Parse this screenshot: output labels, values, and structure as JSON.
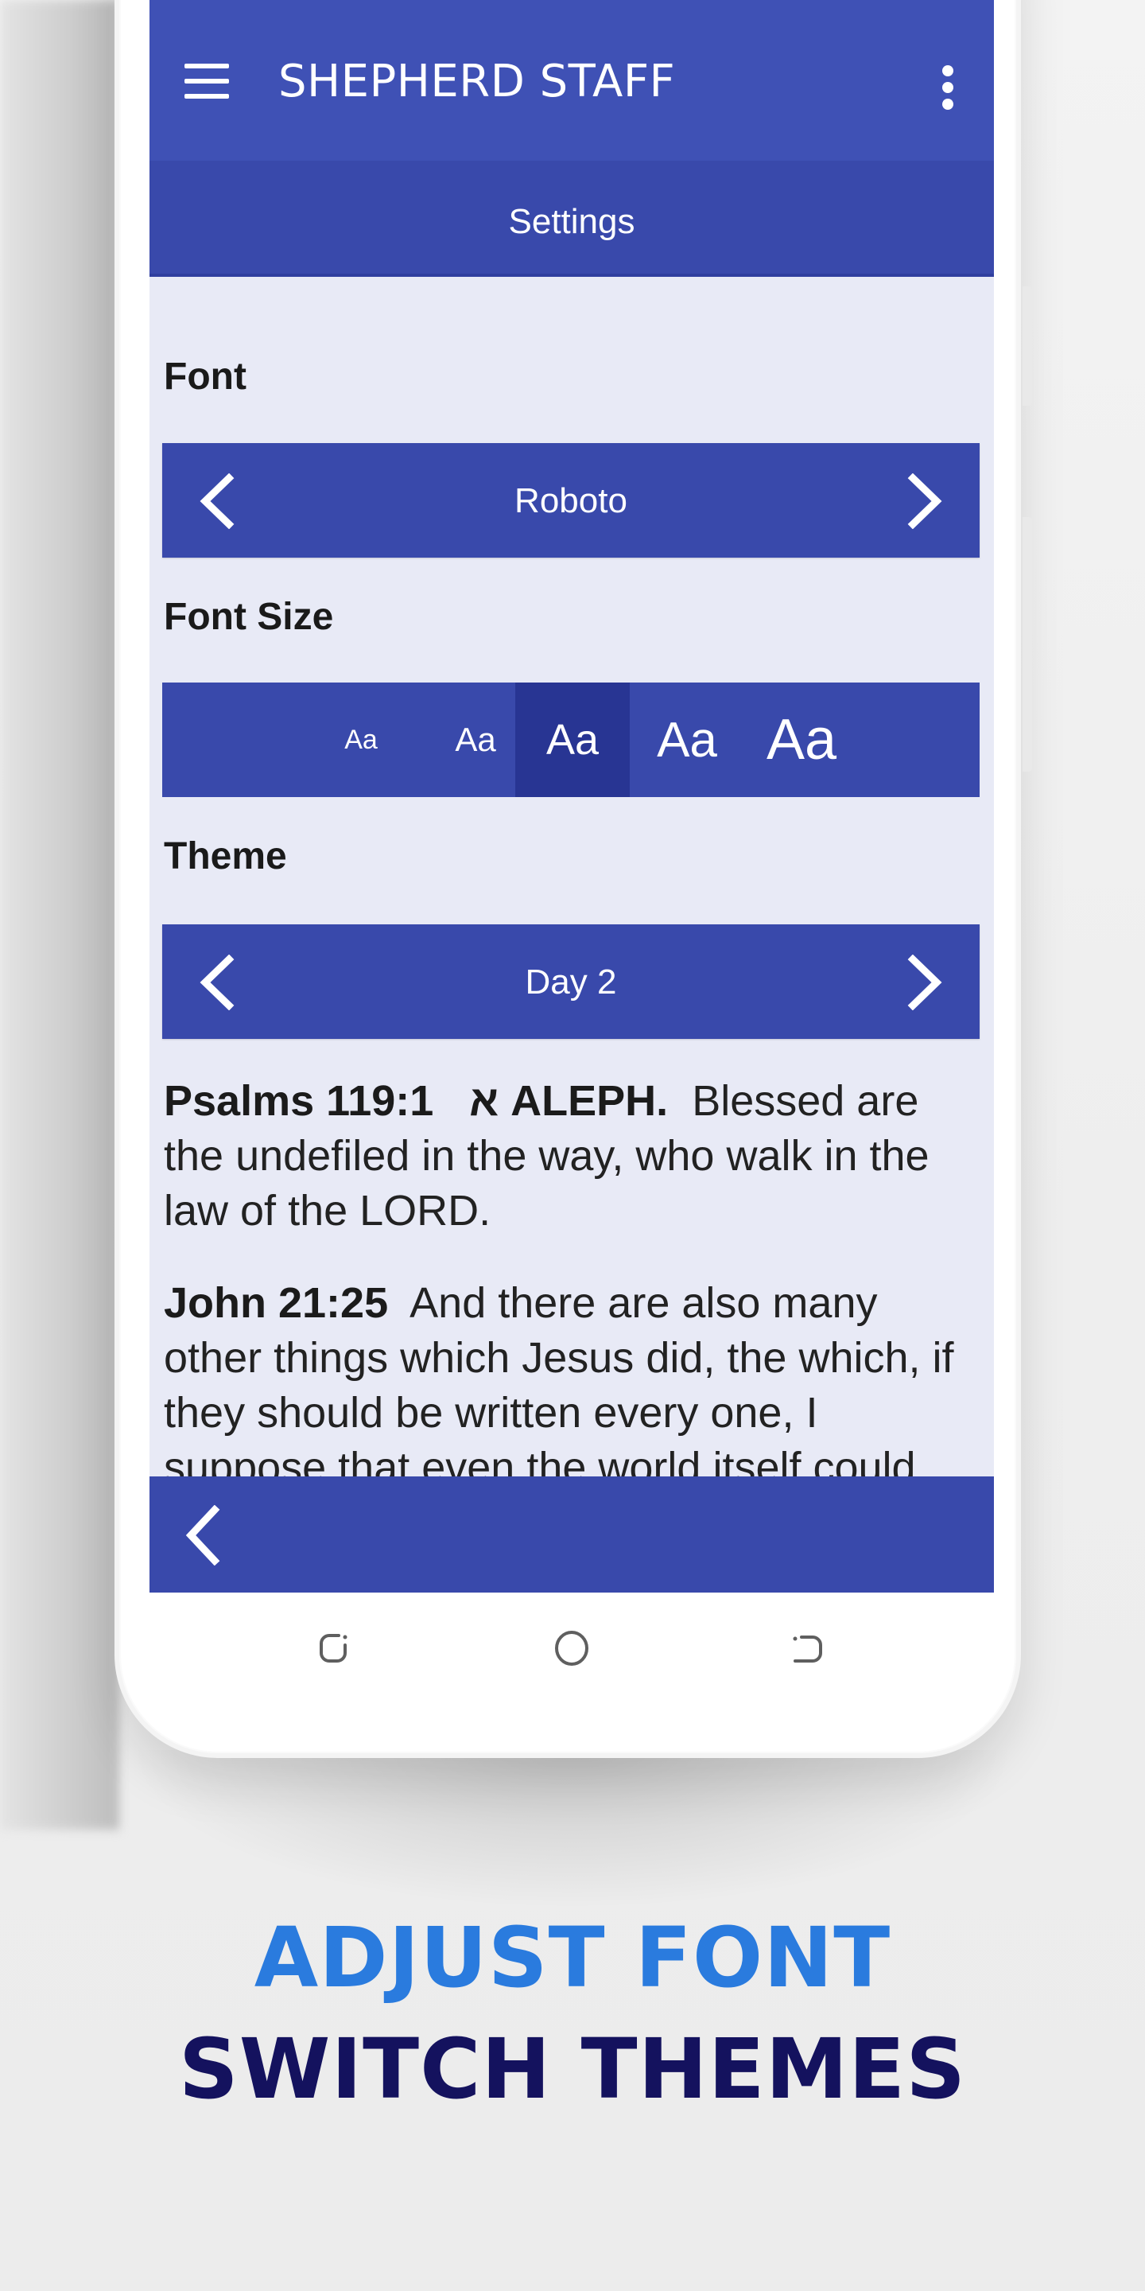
{
  "app": {
    "title": "SHEPHERD STAFF",
    "screen_title": "Settings",
    "menu_icon": "hamburger-menu-icon",
    "overflow_icon": "more-vert-icon"
  },
  "settings": {
    "font": {
      "label": "Font",
      "value": "Roboto",
      "prev_icon": "chevron-left-icon",
      "next_icon": "chevron-right-icon"
    },
    "font_size": {
      "label": "Font Size",
      "options": [
        {
          "label": "Aa",
          "selected": false
        },
        {
          "label": "Aa",
          "selected": false
        },
        {
          "label": "Aa",
          "selected": true
        },
        {
          "label": "Aa",
          "selected": false
        },
        {
          "label": "Aa",
          "selected": false
        }
      ],
      "selected_index": 2
    },
    "theme": {
      "label": "Theme",
      "value": "Day 2",
      "prev_icon": "chevron-left-icon",
      "next_icon": "chevron-right-icon"
    }
  },
  "preview": {
    "verses": [
      {
        "reference": "Psalms 119:1",
        "heading": "א ALEPH.",
        "text": "Blessed are the undefiled in the way, who walk in the law of the LORD."
      },
      {
        "reference": "John 21:25",
        "heading": "",
        "text": "And there are also many other things which Jesus did, the which, if they should be written every one, I suppose that even the world itself could"
      }
    ]
  },
  "bottom_bar": {
    "back_icon": "chevron-left-icon"
  },
  "system_nav": {
    "recents_icon": "recent-apps-icon",
    "home_icon": "home-circle-icon",
    "back_icon": "system-back-icon"
  },
  "promo": {
    "line1": "ADJUST FONT",
    "line2": "SWITCH THEMES"
  },
  "colors": {
    "primary": "#3f51b5",
    "primary_dark": "#3949ab",
    "selected": "#283593",
    "background": "#e8eaf6",
    "promo_blue": "#2a7bde",
    "promo_navy": "#14125e"
  }
}
